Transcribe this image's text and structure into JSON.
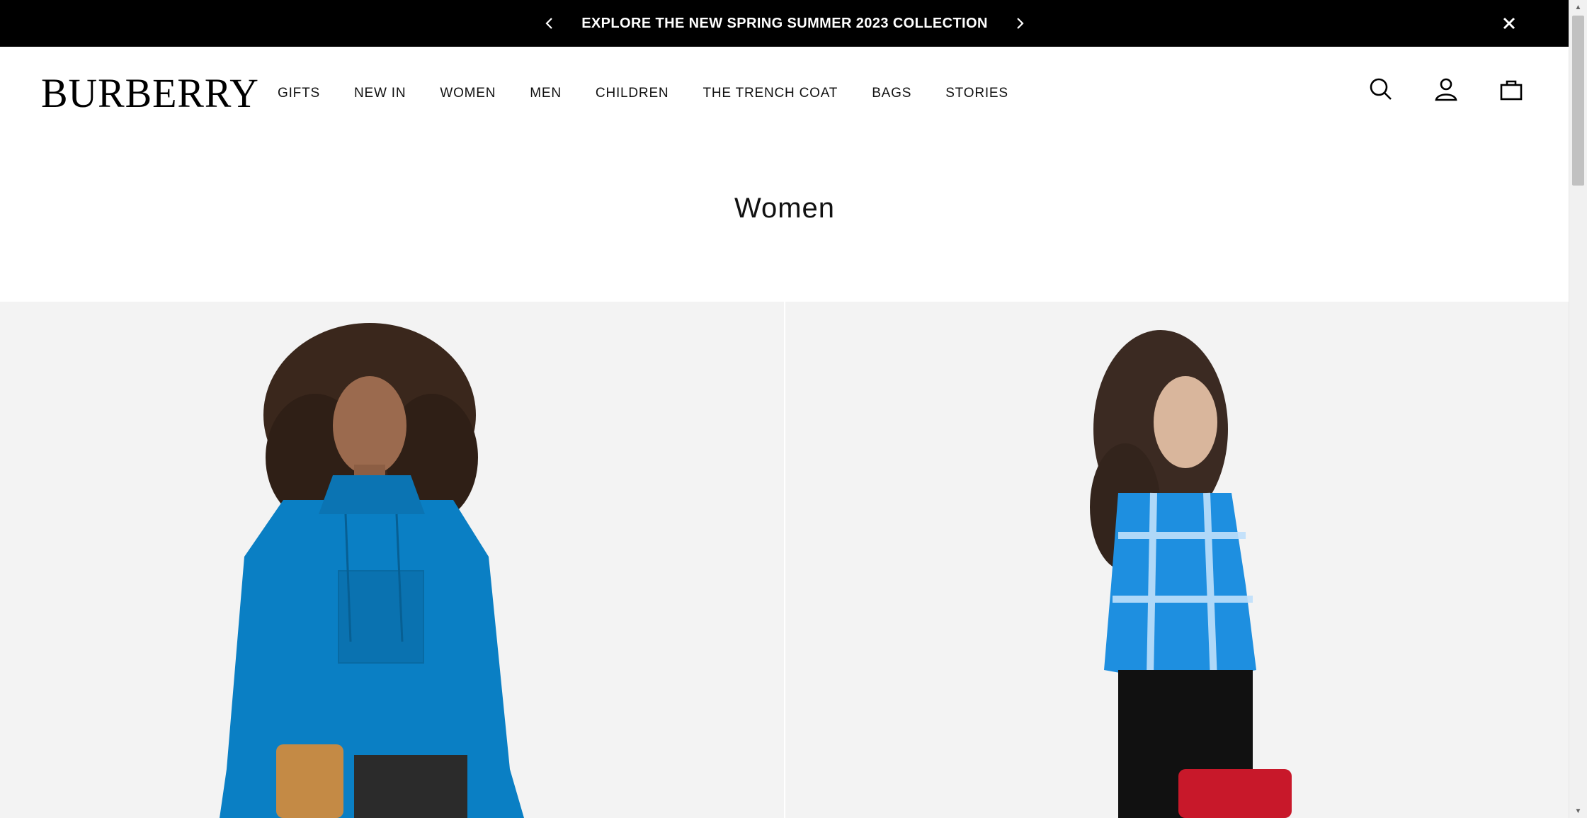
{
  "promo": {
    "text": "EXPLORE THE NEW SPRING SUMMER 2023 COLLECTION",
    "prev_icon": "chevron-left-icon",
    "next_icon": "chevron-right-icon",
    "close_icon": "close-icon"
  },
  "header": {
    "logo": "BURBERRY",
    "nav": [
      "GIFTS",
      "NEW IN",
      "WOMEN",
      "MEN",
      "CHILDREN",
      "THE TRENCH COAT",
      "BAGS",
      "STORIES"
    ],
    "icons": [
      "search-icon",
      "account-icon",
      "bag-icon"
    ]
  },
  "page": {
    "title": "Women"
  },
  "products": [
    {
      "image": "model-blue-anorak",
      "colors": {
        "top": "#0a7fc4",
        "bag": "#c48a45"
      }
    },
    {
      "image": "model-blue-check-shirt",
      "colors": {
        "top": "#1e8fe0",
        "bag": "#c8182a"
      }
    }
  ],
  "colors": {
    "promo_bg": "#000000",
    "tile_bg": "#f3f3f3"
  }
}
